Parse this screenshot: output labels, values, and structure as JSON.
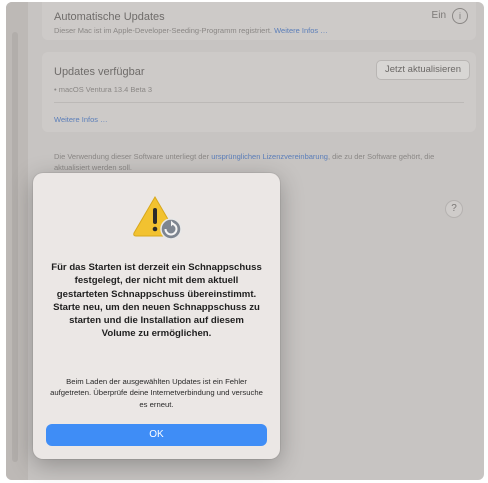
{
  "settings": {
    "automatic_updates": {
      "title": "Automatische Updates",
      "subtitle": "Dieser Mac ist im Apple-Developer-Seeding-Programm registriert.",
      "more_link": "Weitere Infos …",
      "value": "Ein",
      "info_icon": "info-icon"
    },
    "available": {
      "title": "Updates verfügbar",
      "button": "Jetzt aktualisieren",
      "item": "• macOS Ventura 13.4 Beta 3",
      "more_link": "Weitere Infos …"
    },
    "license": {
      "text_before": "Die Verwendung dieser Software unterliegt der ",
      "link": "ursprünglichen Lizenzvereinbarung",
      "text_after": ", die zu der Software gehört, die aktualisiert werden soll."
    },
    "help_label": "?"
  },
  "dialog": {
    "icon": "warning-icon",
    "title": "Für das Starten ist derzeit ein Schnappschuss festgelegt, der nicht mit dem aktuell gestarteten Schnappschuss übereinstimmt. Starte neu, um den neuen Schnappschuss zu starten und die Installation auf diesem Volume zu ermöglichen.",
    "message": "Beim Laden der ausgewählten Updates ist ein Fehler aufgetreten. Überprüfe deine Internetverbindung und versuche es erneut.",
    "ok_label": "OK"
  },
  "colors": {
    "accent": "#3f8df6",
    "warning": "#f2c230",
    "link": "#5b7eb9"
  }
}
